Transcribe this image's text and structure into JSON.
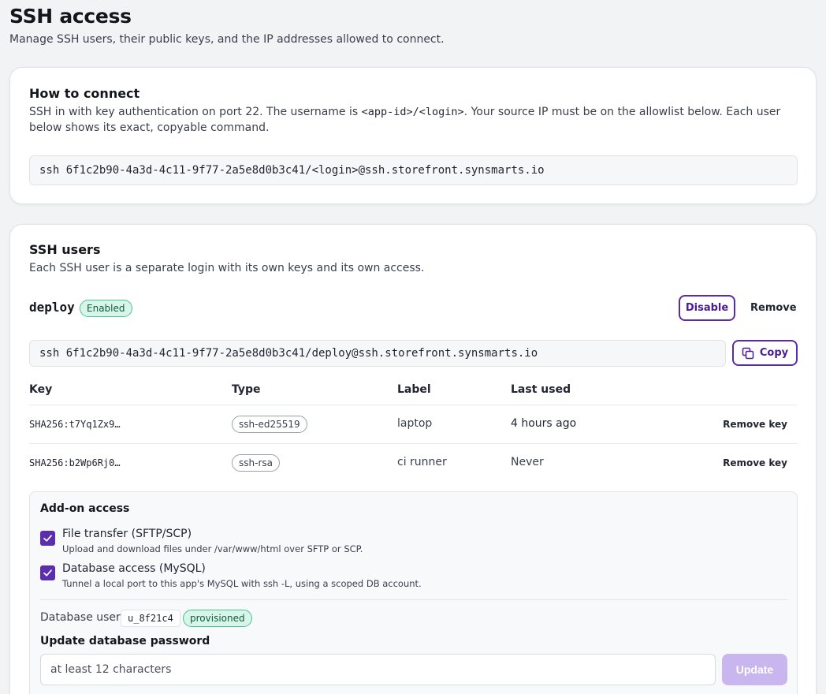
{
  "header": {
    "title": "SSH access",
    "subtitle": "Manage SSH users, their public keys, and the IP addresses allowed to connect."
  },
  "connect": {
    "title": "How to connect",
    "text_before": "SSH in with key authentication on port 22. The username is ",
    "username_format": "<app-id>/<login>",
    "text_after": ". Your source IP must be on the allowlist below. Each user below shows its exact, copyable command.",
    "command": "ssh 6f1c2b90-4a3d-4c11-9f77-2a5e8d0b3c41/<login>@ssh.storefront.synsmarts.io"
  },
  "users": {
    "title": "SSH users",
    "subtitle": "Each SSH user is a separate login with its own keys and its own access.",
    "user": {
      "name": "deploy",
      "status": "Enabled",
      "disable_label": "Disable",
      "remove_label": "Remove",
      "command": "ssh 6f1c2b90-4a3d-4c11-9f77-2a5e8d0b3c41/deploy@ssh.storefront.synsmarts.io",
      "copy_label": "Copy",
      "keys_table": {
        "headers": {
          "key": "Key",
          "type": "Type",
          "label": "Label",
          "last_used": "Last used"
        },
        "rows": [
          {
            "key": "SHA256:t7Yq1Zx9…",
            "type": "ssh-ed25519",
            "label": "laptop",
            "last_used": "4 hours ago",
            "action": "Remove key"
          },
          {
            "key": "SHA256:b2Wp6Rj0…",
            "type": "ssh-rsa",
            "label": "ci runner",
            "last_used": "Never",
            "action": "Remove key"
          }
        ]
      },
      "addons": {
        "title": "Add-on access",
        "options": [
          {
            "label": "File transfer (SFTP/SCP)",
            "description": "Upload and download files under /var/www/html over SFTP or SCP.",
            "checked": true
          },
          {
            "label": "Database access (MySQL)",
            "description": "Tunnel a local port to this app's MySQL with ssh -L, using a scoped DB account.",
            "checked": true
          }
        ],
        "db_user_label": "Database user",
        "db_user": "u_8f21c4",
        "db_user_status": "provisioned",
        "password_title": "Update database password",
        "password_placeholder": "at least 12 characters",
        "password_value": "",
        "update_label": "Update"
      }
    }
  },
  "colors": {
    "accent": "#5b2eb0",
    "badge_bg": "#d8f5ea",
    "badge_border": "#4cc198",
    "update_disabled": "#c9b6ef"
  }
}
